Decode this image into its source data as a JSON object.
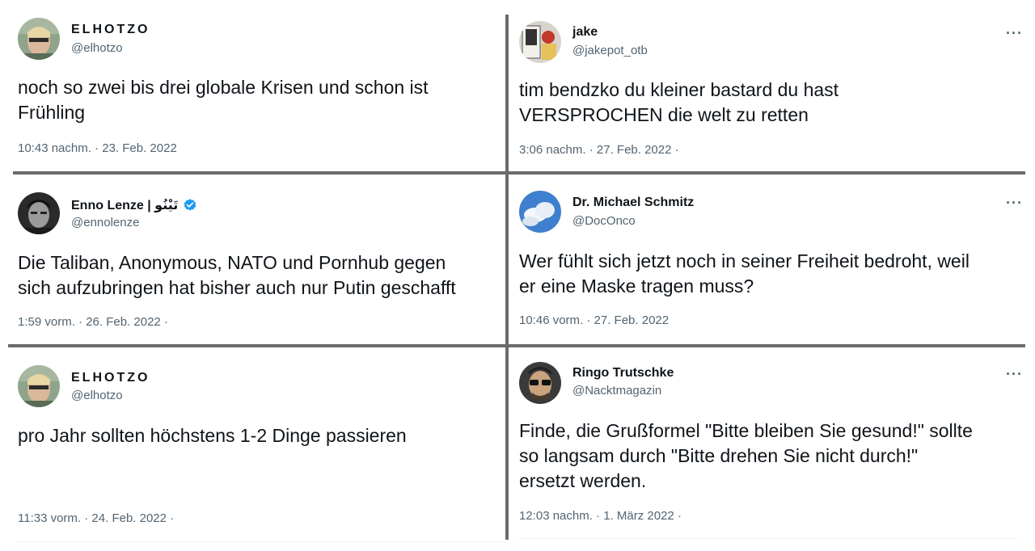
{
  "tweets": [
    {
      "name": "ELHOTZO",
      "handle": "@elhotzo",
      "text": "noch so zwei bis drei globale Krisen und schon ist\nFrühling",
      "meta": "10:43 nachm. · 23. Feb. 2022"
    },
    {
      "name": "jake",
      "handle": "@jakepot_otb",
      "text": "tim bendzko du kleiner bastard du hast\nVERSPROCHEN die welt zu retten",
      "meta": "3:06 nachm. · 27. Feb. 2022 ·",
      "more": "···"
    },
    {
      "name": "Enno Lenze | تَيْنُو",
      "handle": "@ennolenze",
      "text": "Die Taliban, Anonymous, NATO und Pornhub gegen\nsich aufzubringen hat bisher auch nur Putin geschafft",
      "meta": "1:59 vorm. · 26. Feb. 2022 ·",
      "verified_color": "#1d9bf0"
    },
    {
      "name": "Dr. Michael Schmitz",
      "handle": "@DocOnco",
      "text": "Wer fühlt sich jetzt noch in seiner Freiheit bedroht, weil\ner eine Maske tragen muss?",
      "meta": "10:46 vorm. · 27. Feb. 2022",
      "more": "···"
    },
    {
      "name": "ELHOTZO",
      "handle": "@elhotzo",
      "text": "pro Jahr sollten höchstens 1-2 Dinge passieren",
      "meta": "11:33 vorm. · 24. Feb. 2022 ·"
    },
    {
      "name": "Ringo Trutschke",
      "handle": "@Nacktmagazin",
      "text": "Finde, die Grußformel \"Bitte bleiben Sie gesund!\" sollte\nso langsam durch \"Bitte drehen Sie nicht durch!\"\nersetzt werden.",
      "meta": "12:03 nachm. · 1. März 2022 ·",
      "more": "···"
    }
  ],
  "icons": {
    "verified": "verified-badge-icon",
    "more": "more-options-icon"
  }
}
